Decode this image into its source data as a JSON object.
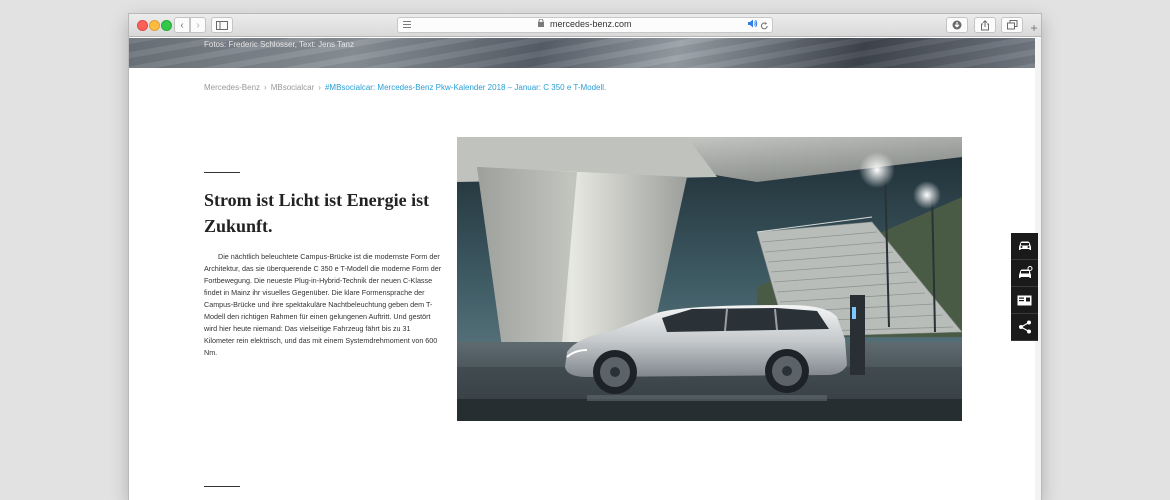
{
  "browser": {
    "url": "mercedes-benz.com",
    "new_tab": "+",
    "back": "‹",
    "forward": "›"
  },
  "hero": {
    "credit": "Fotos: Frederic Schlosser, Text: Jens Tanz"
  },
  "breadcrumb": {
    "items": [
      "Mercedes-Benz",
      "MBsocialcar"
    ],
    "current": "#MBsocialcar: Mercedes-Benz Pkw-Kalender 2018 – Januar: C 350 e T-Modell.",
    "separator": "›"
  },
  "article": {
    "headline_line1": "Strom ist Licht ist Energie ist",
    "headline_line2": "Zukunft.",
    "body": "Die nächtlich beleuchtete Campus-Brücke ist die modernste Form der Architektur, das sie überquerende C 350 e T-Modell die moderne Form der Fortbewegung. Die neueste Plug-in-Hybrid-Technik der neuen C-Klasse findet in Mainz ihr visuelles Gegenüber. Die klare Formensprache der Campus-Brücke und ihre spektakuläre Nachtbeleuchtung geben dem T-Modell den richtigen Rahmen für einen gelungenen Auftritt. Und gestört wird hier heute niemand: Das vielseitige Fahrzeug fährt bis zu 31 Kilometer rein elektrisch, und das mit einem Systemdrehmoment von 600 Nm."
  },
  "side_tools": [
    "car-icon",
    "car-configure-icon",
    "dealer-card-icon",
    "share-icon"
  ],
  "colors": {
    "link": "#2a9fd6",
    "side_tool_bg": "#1a1a1a"
  }
}
